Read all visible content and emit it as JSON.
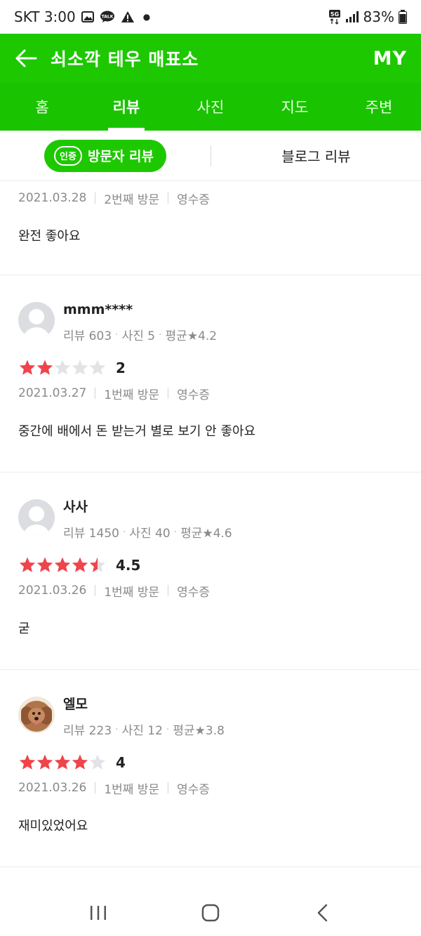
{
  "status_bar": {
    "carrier_time": "SKT 3:00",
    "icons": [
      "image-icon",
      "talk-icon",
      "warning-icon",
      "dot-icon"
    ],
    "right_icons": [
      "5g-icon",
      "signal-icon",
      "battery-icon"
    ],
    "battery": "83%"
  },
  "header": {
    "title": "쇠소깍 테우 매표소",
    "my_label": "MY",
    "bg_color": "#1ec800"
  },
  "tabs": [
    {
      "label": "홈",
      "active": false
    },
    {
      "label": "리뷰",
      "active": true
    },
    {
      "label": "사진",
      "active": false
    },
    {
      "label": "지도",
      "active": false
    },
    {
      "label": "주변",
      "active": false
    }
  ],
  "subtabs": {
    "cert_badge": "인증",
    "visitor_review": "방문자 리뷰",
    "blog_review": "블로그 리뷰"
  },
  "reviews": [
    {
      "date": "2021.03.28",
      "visit": "2번째 방문",
      "receipt": "영수증",
      "text": "완전 좋아요"
    },
    {
      "username": "mmm****",
      "avatar": "default",
      "stats": {
        "reviews": "리뷰 603",
        "photos": "사진 5",
        "avg": "평균★4.2"
      },
      "rating": 2,
      "rating_label": "2",
      "date": "2021.03.27",
      "visit": "1번째 방문",
      "receipt": "영수증",
      "text": "중간에 배에서 돈 받는거 별로 보기 안 좋아요"
    },
    {
      "username": "사사",
      "avatar": "default",
      "stats": {
        "reviews": "리뷰 1450",
        "photos": "사진 40",
        "avg": "평균★4.6"
      },
      "rating": 4.5,
      "rating_label": "4.5",
      "date": "2021.03.26",
      "visit": "1번째 방문",
      "receipt": "영수증",
      "text": "굳"
    },
    {
      "username": "엘모",
      "avatar": "dog",
      "stats": {
        "reviews": "리뷰 223",
        "photos": "사진 12",
        "avg": "평균★3.8"
      },
      "rating": 4,
      "rating_label": "4",
      "date": "2021.03.26",
      "visit": "1번째 방문",
      "receipt": "영수증",
      "text": "재미있었어요"
    }
  ],
  "colors": {
    "star_filled": "#f0444b",
    "star_empty": "#e2e3e7",
    "accent_green": "#1ec800"
  },
  "nav_bar": [
    "recent-apps-icon",
    "home-icon",
    "back-icon"
  ]
}
